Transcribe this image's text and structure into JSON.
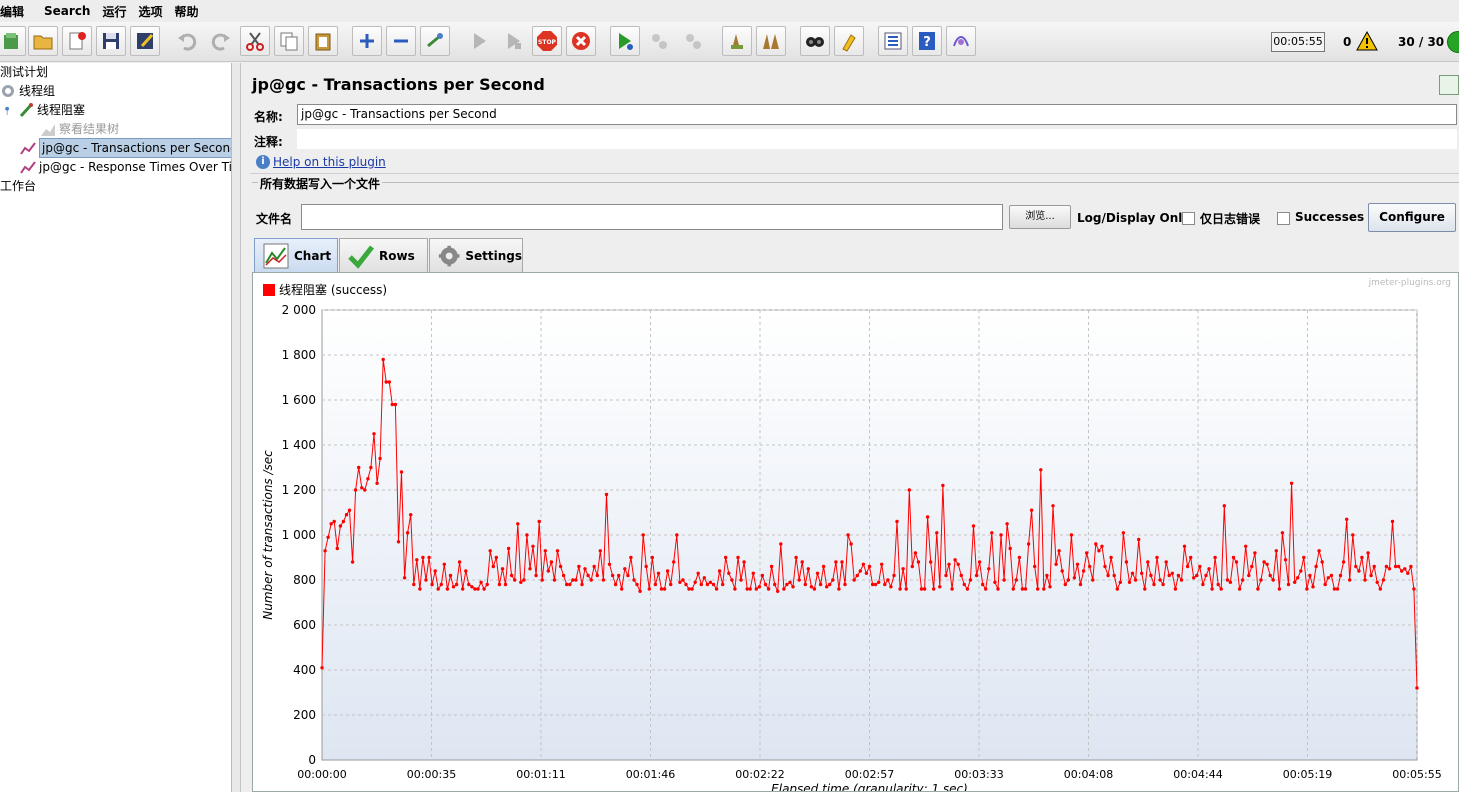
{
  "menu": [
    "编辑",
    "Search",
    "运行",
    "选项",
    "帮助"
  ],
  "toolbar": {
    "buttons": [
      "new-icon",
      "open-icon",
      "close-icon",
      "save-icon",
      "save-as-icon",
      "undo-icon",
      "redo-icon",
      "cut-icon",
      "copy-icon",
      "paste-icon",
      "expand-icon",
      "collapse-icon",
      "toggle-icon",
      "start-icon",
      "start-no-pause-icon",
      "stop-icon",
      "shutdown-icon",
      "remote-start-icon",
      "remote-stop-icon",
      "remote-shutdown-icon",
      "clear-icon",
      "clear-all-icon",
      "search-icon",
      "reset-search-icon",
      "function-helper-icon",
      "help-icon",
      "log-viewer-icon"
    ],
    "elapsed": "00:05:55",
    "error_count": "0",
    "threads": "30 / 30"
  },
  "tree": {
    "items": [
      {
        "label": "测试计划"
      },
      {
        "label": "线程组"
      },
      {
        "label": "线程阻塞"
      },
      {
        "label": "察看结果树"
      },
      {
        "label": "jp@gc - Transactions per Second"
      },
      {
        "label": "jp@gc - Response Times Over Time"
      },
      {
        "label": "工作台"
      }
    ]
  },
  "panel": {
    "title": "jp@gc - Transactions per Second",
    "name_label": "名称:",
    "name_value": "jp@gc - Transactions per Second",
    "comment_label": "注释:",
    "help_link": "Help on this plugin",
    "file_section": "所有数据写入一个文件",
    "file_label": "文件名",
    "browse_button": "浏览...",
    "log_display": "Log/Display Only:",
    "errors_only": "仅日志错误",
    "successes": "Successes",
    "configure_button": "Configure"
  },
  "tabs": [
    {
      "label": "Chart",
      "icon": "chart-icon",
      "active": true
    },
    {
      "label": "Rows",
      "icon": "rows-check-icon",
      "active": false
    },
    {
      "label": "Settings",
      "icon": "settings-gear-icon",
      "active": false
    }
  ],
  "chart_data": {
    "type": "line",
    "watermark": "jmeter-plugins.org",
    "ylabel": "Number of transactions /sec",
    "xlabel": "Elapsed time (granularity: 1 sec)",
    "ylim": [
      0,
      2000
    ],
    "yticks": [
      "0",
      "200",
      "400",
      "600",
      "800",
      "1 000",
      "1 200",
      "1 400",
      "1 600",
      "1 800",
      "2 000"
    ],
    "xticks": [
      "00:00:00",
      "00:00:35",
      "00:01:11",
      "00:01:46",
      "00:02:22",
      "00:02:57",
      "00:03:33",
      "00:04:08",
      "00:04:44",
      "00:05:19",
      "00:05:55"
    ],
    "xlim_seconds": [
      0,
      355
    ],
    "grid": true,
    "legend_position": "top-left",
    "series": [
      {
        "name": "线程阻塞 (success)",
        "color": "#ff0000",
        "values": [
          410,
          930,
          990,
          1050,
          1060,
          940,
          1040,
          1060,
          1090,
          1110,
          880,
          1200,
          1300,
          1210,
          1200,
          1250,
          1300,
          1450,
          1230,
          1340,
          1780,
          1680,
          1680,
          1580,
          1580,
          970,
          1280,
          810,
          1010,
          1090,
          780,
          890,
          760,
          900,
          800,
          900,
          780,
          840,
          760,
          780,
          870,
          760,
          820,
          770,
          780,
          880,
          760,
          840,
          780,
          770,
          760,
          760,
          790,
          760,
          780,
          930,
          860,
          900,
          780,
          850,
          780,
          940,
          820,
          800,
          1050,
          790,
          800,
          1000,
          850,
          950,
          820,
          1060,
          800,
          930,
          840,
          880,
          800,
          930,
          860,
          820,
          780,
          780,
          800,
          800,
          860,
          780,
          850,
          820,
          800,
          860,
          820,
          930,
          800,
          1180,
          870,
          820,
          780,
          820,
          760,
          850,
          820,
          900,
          800,
          780,
          750,
          1000,
          860,
          760,
          900,
          780,
          830,
          760,
          760,
          840,
          780,
          880,
          1000,
          790,
          800,
          780,
          760,
          760,
          790,
          830,
          780,
          810,
          780,
          790,
          780,
          760,
          840,
          780,
          900,
          830,
          800,
          760,
          900,
          800,
          880,
          760,
          760,
          830,
          760,
          770,
          820,
          780,
          760,
          860,
          780,
          750,
          960,
          760,
          780,
          790,
          770,
          900,
          800,
          880,
          780,
          850,
          770,
          760,
          830,
          780,
          860,
          770,
          780,
          800,
          880,
          760,
          880,
          780,
          1000,
          960,
          800,
          820,
          840,
          870,
          830,
          860,
          780,
          780,
          790,
          870,
          780,
          800,
          770,
          820,
          1060,
          760,
          850,
          760,
          1200,
          860,
          920,
          880,
          760,
          760,
          1080,
          880,
          760,
          1010,
          770,
          1220,
          820,
          870,
          760,
          890,
          870,
          820,
          780,
          760,
          800,
          1040,
          820,
          880,
          780,
          760,
          850,
          1010,
          790,
          760,
          1000,
          800,
          1050,
          940,
          760,
          800,
          900,
          760,
          760,
          960,
          1110,
          860,
          760,
          1290,
          760,
          820,
          770,
          1130,
          870,
          930,
          840,
          780,
          800,
          1000,
          810,
          870,
          780,
          840,
          920,
          860,
          800,
          960,
          930,
          950,
          860,
          820,
          900,
          820,
          760,
          790,
          1010,
          880,
          790,
          830,
          800,
          980,
          830,
          760,
          880,
          820,
          780,
          900,
          800,
          780,
          880,
          820,
          830,
          760,
          820,
          800,
          950,
          860,
          900,
          810,
          820,
          860,
          780,
          820,
          850,
          760,
          900,
          780,
          760,
          1130,
          800,
          790,
          900,
          880,
          760,
          800,
          950,
          820,
          860,
          920,
          760,
          800,
          880,
          870,
          820,
          800,
          930,
          760,
          1010,
          890,
          780,
          1230,
          790,
          810,
          840,
          900,
          760,
          820,
          770,
          860,
          930,
          880,
          780,
          810,
          820,
          760,
          760,
          820,
          880,
          1070,
          800,
          1000,
          860,
          840,
          900,
          800,
          920,
          820,
          860,
          790,
          760,
          800,
          860,
          850,
          1060,
          860,
          860,
          840,
          850,
          830,
          860,
          760,
          320
        ]
      }
    ]
  }
}
